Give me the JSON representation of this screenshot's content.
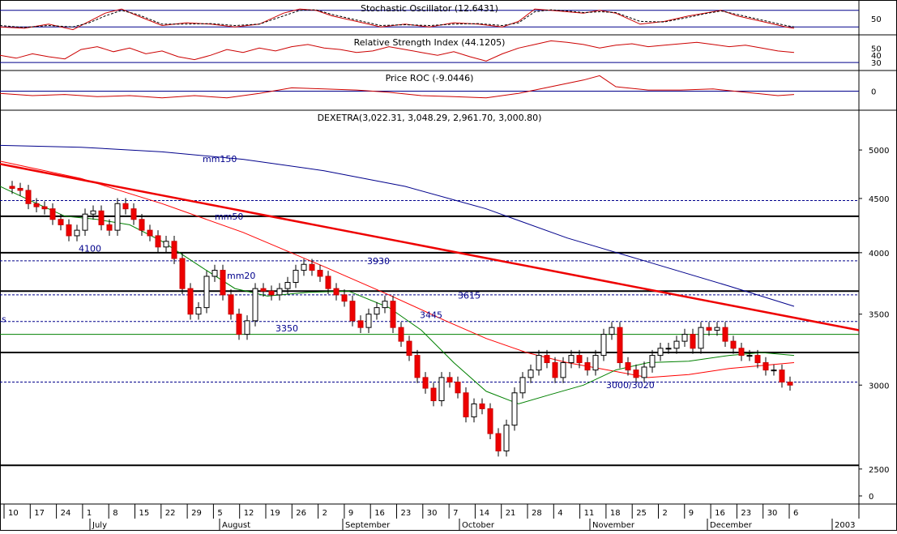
{
  "chart_data": {
    "type": "line",
    "main": {
      "title": "DEXETRA(3,022.31, 3,048.29, 2,961.70, 3,000.80)",
      "y_ticks": [
        5000,
        4500,
        4000,
        3500,
        3000,
        2500,
        0
      ],
      "ylim": [
        2400,
        5300
      ],
      "support_levels": [
        4330,
        4000,
        3680,
        3220,
        2520
      ],
      "dashed_levels": [
        4480,
        3930,
        3650,
        3445,
        3020
      ],
      "trend_line": {
        "start": [
          "Jul 1",
          4850
        ],
        "end": [
          "Dec 31",
          3380
        ]
      },
      "annotations": [
        {
          "text": "mm150",
          "x": 250,
          "y": 4870
        },
        {
          "text": "mm50",
          "x": 265,
          "y": 4300
        },
        {
          "text": "4100",
          "x": 97,
          "y": 4010
        },
        {
          "text": "mm20",
          "x": 280,
          "y": 3780
        },
        {
          "text": "3930",
          "x": 453,
          "y": 3900
        },
        {
          "text": "3615",
          "x": 565,
          "y": 3620
        },
        {
          "text": "3445",
          "x": 518,
          "y": 3470
        },
        {
          "text": "3350",
          "x": 340,
          "y": 3370
        },
        {
          "text": "3000/3020",
          "x": 748,
          "y": 2980
        },
        {
          "text": "s",
          "x": 2,
          "y": 3440
        }
      ],
      "series": [
        {
          "name": "mm150",
          "color": "#00008b",
          "x": [
            0,
            100,
            200,
            300,
            400,
            500,
            600,
            700,
            800,
            900,
            980
          ],
          "y": [
            5050,
            5030,
            4980,
            4900,
            4780,
            4620,
            4400,
            4130,
            3920,
            3720,
            3560
          ]
        },
        {
          "name": "mm50",
          "color": "#ff0000",
          "x": [
            0,
            100,
            200,
            300,
            400,
            480,
            550,
            600,
            650,
            700,
            750,
            800,
            850,
            900,
            980
          ],
          "y": [
            4880,
            4700,
            4450,
            4180,
            3880,
            3650,
            3450,
            3320,
            3220,
            3150,
            3100,
            3050,
            3070,
            3110,
            3150
          ]
        },
        {
          "name": "mm20",
          "color": "#008000",
          "x": [
            0,
            40,
            80,
            120,
            160,
            200,
            250,
            290,
            330,
            380,
            430,
            480,
            520,
            560,
            600,
            640,
            680,
            720,
            760,
            800,
            850,
            900,
            940,
            980
          ],
          "y": [
            4620,
            4470,
            4330,
            4300,
            4250,
            4100,
            3870,
            3700,
            3640,
            3670,
            3680,
            3550,
            3380,
            3150,
            2960,
            2880,
            2940,
            3000,
            3100,
            3150,
            3160,
            3200,
            3220,
            3200
          ]
        }
      ],
      "close_series": {
        "x": [
          5,
          15,
          25,
          35,
          45,
          55,
          65,
          75,
          85,
          95,
          105,
          115,
          125,
          135,
          145,
          155,
          165,
          175,
          185,
          195,
          205,
          215,
          225,
          235,
          245,
          255,
          265,
          275,
          285,
          295,
          305,
          315,
          325,
          335,
          345,
          355,
          365,
          375,
          385,
          395,
          405,
          415,
          425,
          435,
          445,
          455,
          465,
          475,
          485,
          495,
          505,
          515,
          525,
          535,
          545,
          555,
          565,
          575,
          585,
          595,
          605,
          615,
          625,
          635,
          645,
          655,
          665,
          675,
          685,
          695,
          705,
          715,
          725,
          735,
          745,
          755,
          765,
          775,
          785,
          795,
          805,
          815,
          825,
          835,
          845,
          855,
          865,
          875,
          885,
          895,
          905,
          915,
          925,
          935,
          945,
          955,
          965,
          975
        ],
        "y": [
          4620,
          4600,
          4580,
          4450,
          4420,
          4400,
          4300,
          4250,
          4150,
          4200,
          4350,
          4380,
          4250,
          4200,
          4450,
          4400,
          4300,
          4200,
          4150,
          4050,
          4100,
          3950,
          3700,
          3500,
          3550,
          3800,
          3850,
          3650,
          3500,
          3350,
          3450,
          3700,
          3680,
          3650,
          3700,
          3750,
          3850,
          3900,
          3850,
          3800,
          3700,
          3650,
          3600,
          3450,
          3400,
          3500,
          3550,
          3600,
          3400,
          3300,
          3200,
          3050,
          2980,
          2900,
          3050,
          3020,
          2950,
          2800,
          2880,
          2850,
          2700,
          2600,
          2750,
          2950,
          3050,
          3100,
          3200,
          3150,
          3050,
          3150,
          3200,
          3150,
          3100,
          3200,
          3350,
          3400,
          3150,
          3100,
          3050,
          3120,
          3200,
          3250,
          3250,
          3300,
          3350,
          3250,
          3400,
          3380,
          3400,
          3300,
          3250,
          3200,
          3200,
          3150,
          3100,
          3100,
          3020,
          3000
        ]
      }
    },
    "stochastic": {
      "title": "Stochastic Oscillator (12.6431)",
      "y_ticks": [
        50
      ],
      "ylim": [
        0,
        100
      ],
      "levels": [
        80,
        20
      ],
      "x": [
        0,
        30,
        60,
        90,
        110,
        130,
        150,
        170,
        200,
        230,
        260,
        290,
        320,
        350,
        370,
        390,
        410,
        440,
        470,
        500,
        530,
        560,
        590,
        620,
        640,
        660,
        680,
        700,
        720,
        740,
        760,
        790,
        820,
        850,
        870,
        890,
        910,
        940,
        970,
        980
      ],
      "k": [
        20,
        15,
        30,
        10,
        40,
        70,
        85,
        60,
        25,
        35,
        30,
        20,
        30,
        70,
        85,
        80,
        60,
        40,
        20,
        30,
        20,
        35,
        30,
        20,
        40,
        85,
        80,
        75,
        70,
        80,
        70,
        30,
        40,
        60,
        70,
        80,
        60,
        40,
        20,
        15
      ],
      "d": [
        25,
        18,
        25,
        20,
        35,
        60,
        80,
        65,
        30,
        30,
        32,
        25,
        30,
        60,
        80,
        82,
        65,
        45,
        25,
        28,
        25,
        30,
        32,
        25,
        35,
        75,
        82,
        78,
        72,
        75,
        72,
        40,
        38,
        55,
        68,
        78,
        65,
        45,
        25,
        20
      ]
    },
    "rsi": {
      "title": "Relative Strength Index (44.1205)",
      "y_ticks": [
        50,
        40,
        30
      ],
      "ylim": [
        20,
        65
      ],
      "levels": [
        30
      ],
      "x": [
        0,
        20,
        40,
        60,
        80,
        100,
        120,
        140,
        160,
        180,
        200,
        220,
        240,
        260,
        280,
        300,
        320,
        340,
        360,
        380,
        400,
        420,
        440,
        460,
        480,
        500,
        520,
        540,
        560,
        580,
        600,
        620,
        640,
        660,
        680,
        700,
        720,
        740,
        760,
        780,
        800,
        820,
        840,
        860,
        880,
        900,
        920,
        940,
        960,
        980
      ],
      "y": [
        40,
        36,
        42,
        38,
        35,
        48,
        52,
        45,
        50,
        42,
        46,
        38,
        34,
        40,
        48,
        44,
        50,
        46,
        52,
        55,
        50,
        48,
        44,
        46,
        52,
        48,
        44,
        40,
        45,
        38,
        32,
        42,
        50,
        55,
        60,
        58,
        55,
        50,
        54,
        56,
        52,
        54,
        56,
        58,
        55,
        52,
        54,
        50,
        46,
        44
      ]
    },
    "roc": {
      "title": "Price ROC (-9.0446)",
      "y_ticks": [
        0
      ],
      "ylim": [
        -15,
        15
      ],
      "levels": [
        0
      ],
      "x": [
        0,
        40,
        80,
        120,
        160,
        200,
        240,
        280,
        320,
        360,
        400,
        440,
        480,
        520,
        560,
        600,
        640,
        680,
        720,
        740,
        760,
        800,
        840,
        880,
        920,
        960,
        980
      ],
      "y": [
        -2,
        -4,
        -3,
        -5,
        -4,
        -6,
        -4,
        -6,
        -2,
        3,
        2,
        1,
        -1,
        -4,
        -5,
        -6,
        -2,
        4,
        10,
        14,
        4,
        1,
        1,
        2,
        -1,
        -4,
        -3
      ]
    },
    "x_axis": {
      "ticks": [
        "10",
        "17",
        "24",
        "1",
        "8",
        "15",
        "22",
        "29",
        "5",
        "12",
        "19",
        "26",
        "2",
        "9",
        "16",
        "23",
        "30",
        "7",
        "14",
        "21",
        "28",
        "4",
        "11",
        "18",
        "25",
        "2",
        "9",
        "16",
        "23",
        "30",
        "6"
      ],
      "months": [
        "July",
        "August",
        "September",
        "October",
        "November",
        "December",
        "2003"
      ]
    }
  }
}
